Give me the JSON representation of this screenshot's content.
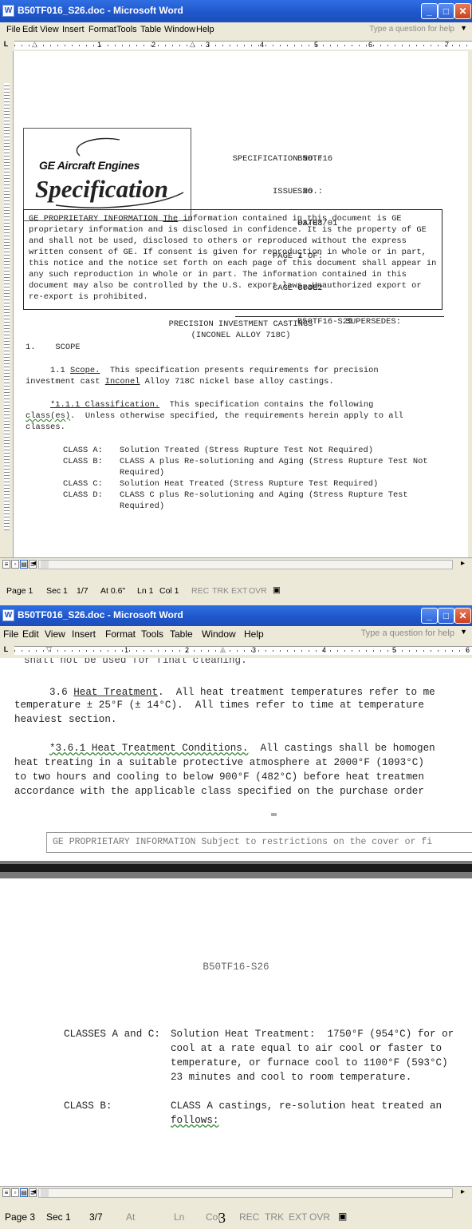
{
  "window1": {
    "title": "B50TF016_S26.doc - Microsoft Word",
    "title_icon": "W",
    "menu": [
      "File",
      "Edit",
      "View",
      "Insert",
      "Format",
      "Tools",
      "Table",
      "Window",
      "Help"
    ],
    "help_placeholder": "Type a question for help",
    "ruler_numbers": [
      "1",
      "2",
      "3",
      "4",
      "5",
      "6",
      "7"
    ],
    "logo": {
      "line1": "GE Aircraft Engines",
      "line2": "Specification"
    },
    "spec_rows": [
      {
        "label": "SPECIFICATION NO.:",
        "value": "B50TF16"
      },
      {
        "label": "ISSUE NO.:",
        "value": "S26"
      },
      {
        "label": "DATE:",
        "value": "03/08/01"
      },
      {
        "label": "PAGE 1 OF:",
        "value": "7"
      },
      {
        "label": "CAGE CODE:",
        "value": "07482"
      },
      {
        "label": "SUPERSEDES:",
        "value": "B50TF16-S25"
      }
    ],
    "notice_lead": "GE PROPRIETARY INFORMATION ",
    "notice_the": "The",
    "notice_rest": " information contained in this document is GE proprietary information and is disclosed in confidence.  It is the property of GE and shall not be used, disclosed to others or reproduced without the express written consent of GE.  If consent is given for reproduction in whole or in part, this notice and the notice set forth on each page of this document shall appear in any such reproduction in whole or in part.  The information contained in this document may also be controlled by the U.S. export laws.  Unauthorized export or re-export is prohibited.",
    "doc_title1": "PRECISION INVESTMENT CASTINGS",
    "doc_title2": "(INCONEL ALLOY 718C)",
    "section1": "1.    SCOPE",
    "p11_num": "1.1 ",
    "p11_head": "Scope.",
    "p11_a": "  This specification presents requirements for precision",
    "p11_b1": "investment cast ",
    "p11_b2": "Inconel",
    "p11_b3": " Alloy 718C nickel base alloy castings.",
    "p111_head": "*1.1.1 Classification.",
    "p111_a": "  This specification contains the following",
    "p111_b1": "class(es)",
    "p111_b2": ".  Unless otherwise specified, the requirements herein apply to all",
    "p111_c": "classes.",
    "classes": [
      {
        "label": "CLASS A:",
        "lines": [
          "Solution Treated (Stress Rupture Test Not Required)"
        ]
      },
      {
        "label": "CLASS B:",
        "lines": [
          "CLASS A plus Re-solutioning and Aging (Stress Rupture Test Not",
          "Required)"
        ]
      },
      {
        "label": "CLASS C:",
        "lines": [
          "Solution Heat Treated (Stress Rupture Test Required)"
        ]
      },
      {
        "label": "CLASS D:",
        "lines": [
          "CLASS C plus Re-solutioning and Aging (Stress Rupture Test",
          "Required)"
        ]
      }
    ],
    "status": {
      "page": "Page 1",
      "sec": "Sec 1",
      "pos": "1/7",
      "at": "At 0.6\"",
      "ln": "Ln 1",
      "col": "Col 1",
      "rec": "REC",
      "trk": "TRK",
      "ext": "EXT",
      "ovr": "OVR"
    }
  },
  "window2": {
    "title": "B50TF016_S26.doc - Microsoft Word",
    "menu": [
      "File",
      "Edit",
      "View",
      "Insert",
      "Format",
      "Tools",
      "Table",
      "Window",
      "Help"
    ],
    "help_placeholder": "Type a question for help",
    "ruler_numbers": [
      "1",
      "2",
      "3",
      "4",
      "5",
      "6"
    ],
    "clipped_line": "shall not be used for final cleaning.",
    "p36_num": "3.6 ",
    "p36_head": "Heat Treatment",
    "p36_a": ".  All heat treatment temperatures refer to me",
    "p36_b": "temperature ± 25°F (± 14°C).  All times refer to time at temperature",
    "p36_c": "heaviest section.",
    "p361_head": "*3.6.1 Heat Treatment Conditions.",
    "p361_a": "  All castings shall be homogen",
    "p361_b": "heat treating in a suitable protective atmosphere at 2000°F (1093°C)",
    "p361_c": "to two hours and cooling to below 900°F (482°C) before heat treatmen",
    "p361_d": "accordance with the applicable class specified on the purchase order",
    "footer_notice": "GE PROPRIETARY INFORMATION Subject to restrictions on the cover or fi",
    "page_header": "B50TF16-S26",
    "ac_label": "CLASSES A and C:",
    "ac_lines": [
      "Solution Heat Treatment:  1750°F (954°C) for or",
      "cool at a rate equal to air cool or faster to",
      "temperature, or furnace cool to 1100°F (593°C)",
      "23 minutes and cool to room temperature."
    ],
    "b_label": "CLASS B:",
    "b_line1": "CLASS A castings, re-solution heat treated an",
    "b_line2": "follows:",
    "status": {
      "page": "Page 3",
      "sec": "Sec 1",
      "pos": "3/7",
      "at": "At",
      "ln": "Ln",
      "col": "Col",
      "page_num": "3",
      "rec": "REC",
      "trk": "TRK",
      "ext": "EXT",
      "ovr": "OVR"
    }
  }
}
